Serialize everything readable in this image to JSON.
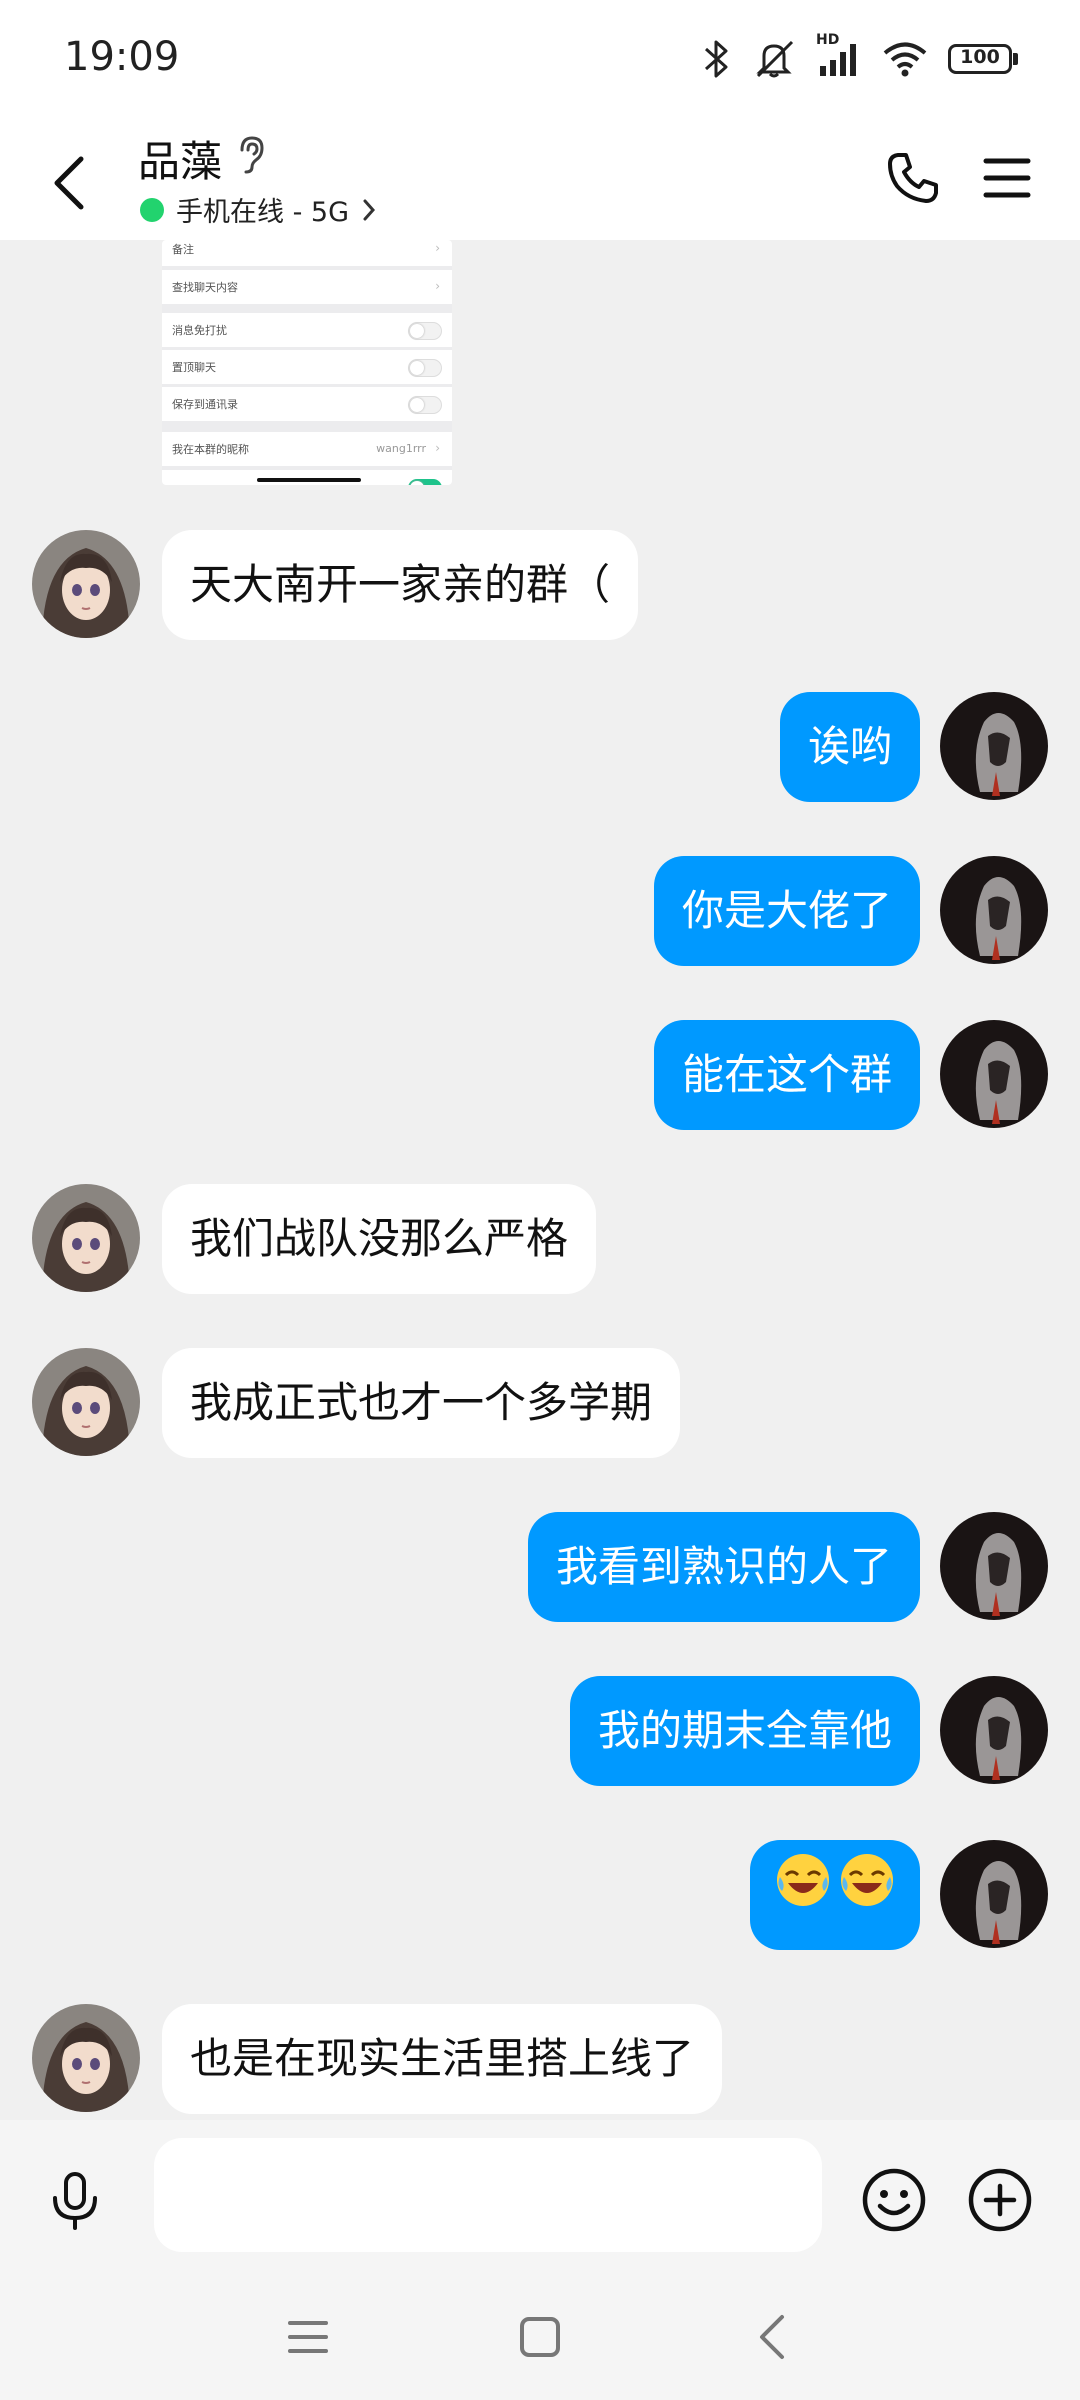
{
  "status_bar": {
    "time": "19:09",
    "network_badge": "HD",
    "battery": "100",
    "icons": [
      "bluetooth-icon",
      "silent-icon",
      "signal-icon",
      "wifi-icon",
      "battery-icon"
    ]
  },
  "header": {
    "contact_name": "品藻",
    "presence": "手机在线 - 5G",
    "presence_color": "#22d36e",
    "icons": [
      "back-icon",
      "ear-icon",
      "phone-icon",
      "menu-icon"
    ]
  },
  "screenshot_image": {
    "rows": [
      {
        "label": "备注"
      },
      {
        "label": "查找聊天内容"
      },
      {
        "label": "消息免打扰"
      },
      {
        "label": "置顶聊天"
      },
      {
        "label": "保存到通讯录"
      },
      {
        "label": "我在本群的昵称",
        "value": "wang1rrr"
      }
    ]
  },
  "messages": [
    {
      "side": "left",
      "text": "天大南开一家亲的群（"
    },
    {
      "side": "right",
      "text": "诶哟"
    },
    {
      "side": "right",
      "text": "你是大佬了"
    },
    {
      "side": "right",
      "text": "能在这个群"
    },
    {
      "side": "left",
      "text": "我们战队没那么严格"
    },
    {
      "side": "left",
      "text": "我成正式也才一个多学期"
    },
    {
      "side": "right",
      "text": "我看到熟识的人了"
    },
    {
      "side": "right",
      "text": "我的期末全靠他"
    },
    {
      "side": "right",
      "emoji": [
        "laughing-crying-emoji",
        "laughing-crying-emoji"
      ]
    },
    {
      "side": "left",
      "text": "也是在现实生活里搭上线了"
    }
  ],
  "input": {
    "placeholder": "",
    "icons": [
      "microphone-icon",
      "emoji-icon",
      "plus-icon"
    ]
  },
  "nav": {
    "icons": [
      "recents-icon",
      "home-icon",
      "back-nav-icon"
    ]
  },
  "colors": {
    "outgoing_bubble": "#0099ff",
    "incoming_bubble": "#ffffff",
    "background": "#f0f0f0"
  }
}
